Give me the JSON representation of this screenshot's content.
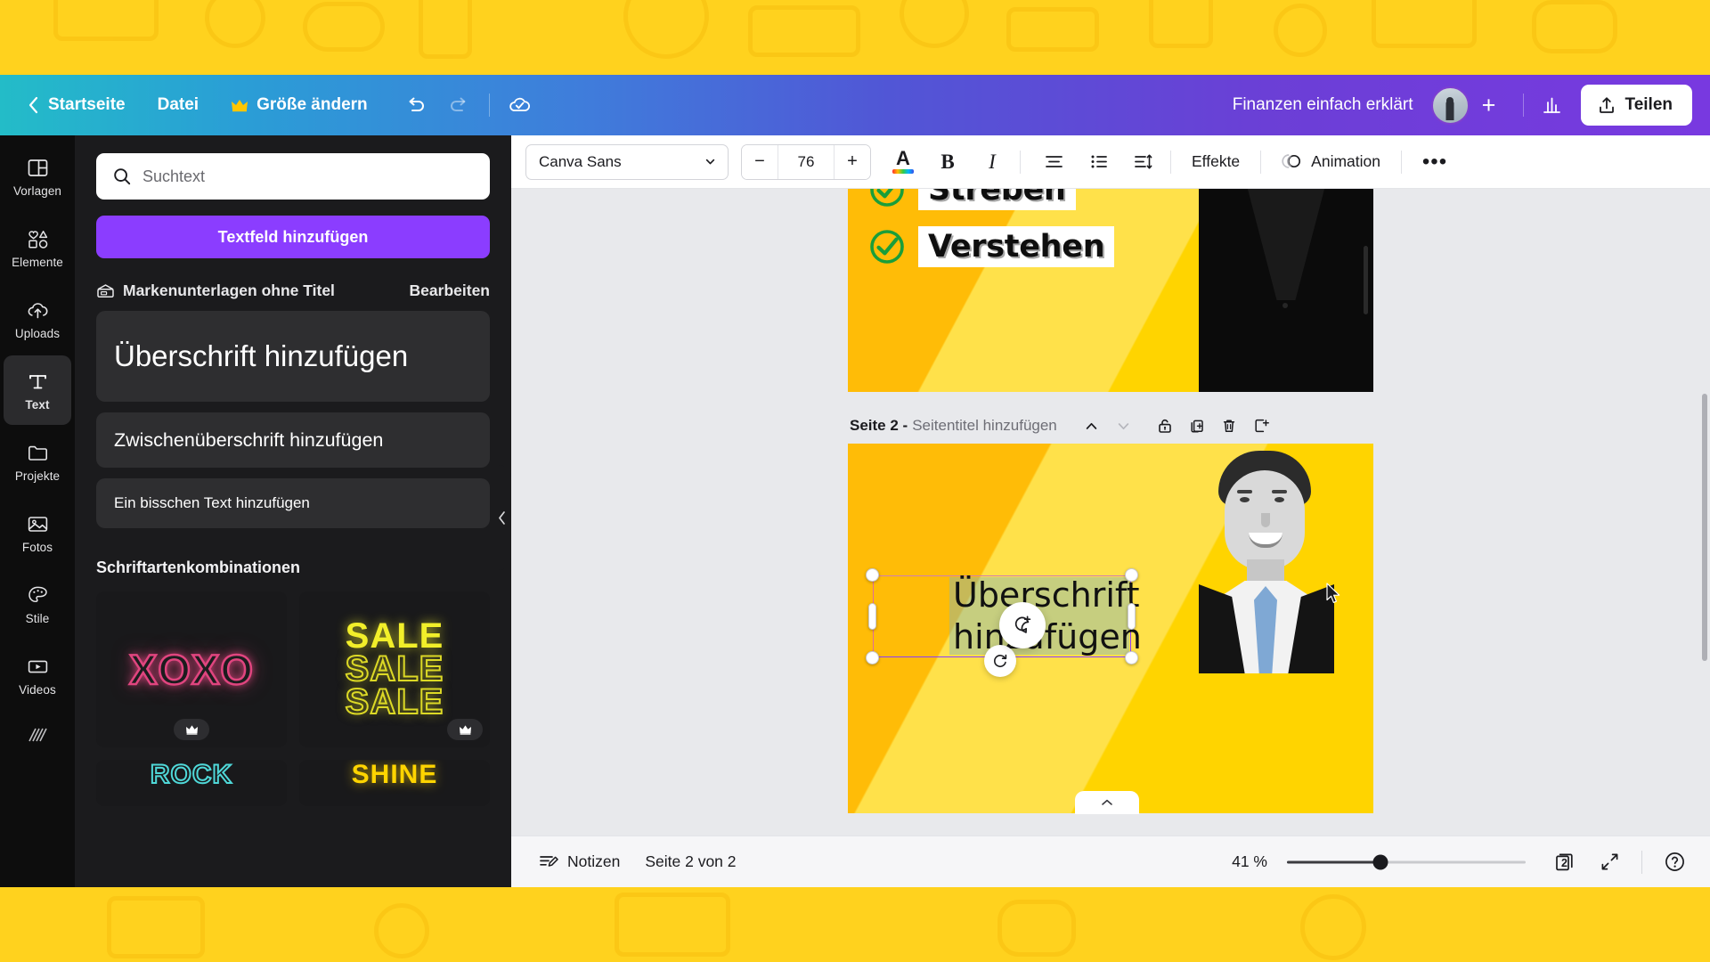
{
  "header": {
    "back_label": "Startseite",
    "file_label": "Datei",
    "resize_label": "Größe ändern",
    "resize_icon": "crown-icon",
    "undo_icon": "undo-icon",
    "redo_icon": "redo-icon",
    "saved_icon": "cloud-check-icon",
    "doc_title": "Finanzen einfach erklärt",
    "add_collab_icon": "plus-icon",
    "insights_icon": "bar-chart-icon",
    "share_label": "Teilen",
    "share_icon": "upload-icon"
  },
  "rail": {
    "items": [
      {
        "label": "Vorlagen",
        "icon": "templates-icon",
        "active": false
      },
      {
        "label": "Elemente",
        "icon": "elements-icon",
        "active": false
      },
      {
        "label": "Uploads",
        "icon": "cloud-upload-icon",
        "active": false
      },
      {
        "label": "Text",
        "icon": "text-t-icon",
        "active": true
      },
      {
        "label": "Projekte",
        "icon": "folder-icon",
        "active": false
      },
      {
        "label": "Fotos",
        "icon": "photo-icon",
        "active": false
      },
      {
        "label": "Stile",
        "icon": "palette-icon",
        "active": false
      },
      {
        "label": "Videos",
        "icon": "video-icon",
        "active": false
      }
    ]
  },
  "panel": {
    "search": {
      "value": "",
      "placeholder": "Suchtext",
      "icon": "search-icon"
    },
    "add_text_button": "Textfeld hinzufügen",
    "brand_icon": "brand-kit-icon",
    "brand_name": "Markenunterlagen ohne Titel",
    "brand_edit": "Bearbeiten",
    "styles": [
      {
        "label": "Überschrift hinzufügen",
        "size": "heading"
      },
      {
        "label": "Zwischenüberschrift hinzufügen",
        "size": "sub"
      },
      {
        "label": "Ein bisschen Text hinzufügen",
        "size": "body"
      }
    ],
    "combos_title": "Schriftartenkombinationen",
    "combos": [
      {
        "name": "xoxo-neon",
        "text": "XOXO",
        "pro": true,
        "pro_icon": "crown-icon",
        "color": "#e0457f"
      },
      {
        "name": "sale-neon",
        "text": "SALE",
        "pro": true,
        "pro_icon": "crown-icon",
        "color": "#f2ef2a"
      }
    ],
    "combos_row2": [
      {
        "name": "teal-outline",
        "text": "ROCK"
      },
      {
        "name": "shine-gold",
        "text": "SHINE"
      }
    ],
    "collapse_icon": "chevron-left-icon"
  },
  "toolbar": {
    "font_family": "Canva Sans",
    "font_dropdown_icon": "chevron-down-icon",
    "font_size": "76",
    "decrease_label": "−",
    "increase_label": "+",
    "text_color_icon": "font-color-icon",
    "bold_label": "B",
    "italic_label": "I",
    "align_icon": "align-center-icon",
    "list_icon": "bullet-list-icon",
    "spacing_icon": "line-spacing-icon",
    "effects_label": "Effekte",
    "animation_label": "Animation",
    "animation_icon": "animation-icon",
    "more_icon": "more-dots-icon"
  },
  "canvas": {
    "page1": {
      "checkrows": [
        {
          "text": "Streben",
          "icon": "check-circle-icon"
        },
        {
          "text": "Verstehen",
          "icon": "check-circle-icon"
        }
      ]
    },
    "page2": {
      "header_title": "Seite 2 -",
      "header_placeholder": "Seitentitel hinzufügen",
      "actions": [
        {
          "name": "move-page-up-button",
          "icon": "chevron-up-icon",
          "disabled": false
        },
        {
          "name": "move-page-down-button",
          "icon": "chevron-down-icon",
          "disabled": true
        },
        {
          "name": "lock-page-button",
          "icon": "lock-icon",
          "disabled": false
        },
        {
          "name": "duplicate-page-button",
          "icon": "duplicate-icon",
          "disabled": false
        },
        {
          "name": "delete-page-button",
          "icon": "trash-icon",
          "disabled": false
        },
        {
          "name": "add-page-button",
          "icon": "add-page-icon",
          "disabled": false
        }
      ],
      "selected_text_line1": "Überschrift",
      "selected_text_line2": "hinzufügen",
      "rotate_icon": "rotate-icon",
      "comment_icon": "add-comment-icon",
      "expand_tab_icon": "chevron-up-icon"
    }
  },
  "statusbar": {
    "notes_label": "Notizen",
    "notes_icon": "notes-icon",
    "page_indicator": "Seite 2 von 2",
    "zoom_value": "41 %",
    "page_count": "2",
    "grid_icon": "pages-grid-icon",
    "fullscreen_icon": "expand-icon",
    "help_icon": "help-icon"
  }
}
